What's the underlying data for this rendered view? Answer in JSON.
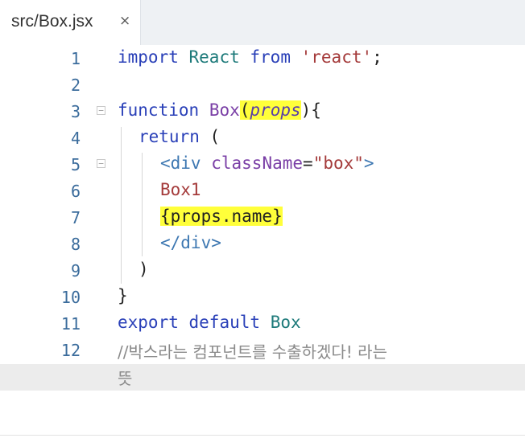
{
  "tab": {
    "title": "src/Box.jsx",
    "close": "×"
  },
  "fold_marker": "−",
  "lines": [
    {
      "num": "1",
      "t": [
        "import",
        " ",
        "React",
        " ",
        "from",
        " ",
        "'react'",
        ";"
      ]
    },
    {
      "num": "2"
    },
    {
      "num": "3",
      "t": [
        "function",
        " ",
        "Box",
        "(",
        "props",
        "){"
      ]
    },
    {
      "num": "4",
      "t": [
        "return",
        " ("
      ]
    },
    {
      "num": "5",
      "t": [
        "<div",
        " ",
        "className",
        "=",
        "\"box\"",
        ">"
      ]
    },
    {
      "num": "6",
      "t": [
        "Box1"
      ]
    },
    {
      "num": "7",
      "t": [
        "{props.name}"
      ]
    },
    {
      "num": "8",
      "t": [
        "</div>"
      ]
    },
    {
      "num": "9",
      "t": [
        ")"
      ]
    },
    {
      "num": "10",
      "t": [
        "}"
      ]
    },
    {
      "num": "11",
      "t": [
        "export",
        " ",
        "default",
        " ",
        "Box"
      ]
    },
    {
      "num": "12",
      "t": [
        "//박스라는 컴포넌트를 수출하겠다! 라는",
        "뜻"
      ]
    }
  ]
}
